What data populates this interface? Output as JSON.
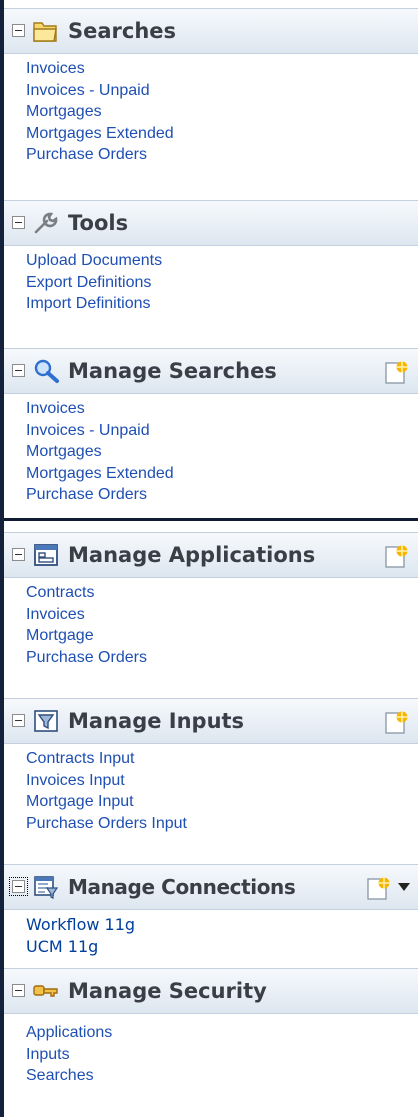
{
  "panels": [
    {
      "id": "searches",
      "title": "Searches",
      "icon": "folder-icon",
      "items": [
        "Invoices",
        "Invoices - Unpaid",
        "Mortgages",
        "Mortgages Extended",
        "Purchase Orders"
      ]
    },
    {
      "id": "tools",
      "title": "Tools",
      "icon": "wrench-icon",
      "items": [
        "Upload Documents",
        "Export Definitions",
        "Import Definitions"
      ]
    },
    {
      "id": "manage-searches",
      "title": "Manage Searches",
      "icon": "magnifier-icon",
      "has_new": true,
      "items": [
        "Invoices",
        "Invoices - Unpaid",
        "Mortgages",
        "Mortgages Extended",
        "Purchase Orders"
      ]
    },
    {
      "id": "manage-applications",
      "title": "Manage Applications",
      "icon": "application-window-icon",
      "has_new": true,
      "items": [
        "Contracts",
        "Invoices",
        "Mortgage",
        "Purchase Orders"
      ]
    },
    {
      "id": "manage-inputs",
      "title": "Manage Inputs",
      "icon": "filter-funnel-icon",
      "has_new": true,
      "items": [
        "Contracts Input",
        "Invoices Input",
        "Mortgage Input",
        "Purchase Orders Input"
      ]
    },
    {
      "id": "manage-connections",
      "title": "Manage Connections",
      "icon": "connection-form-icon",
      "has_new": true,
      "has_menu": true,
      "items": [
        "Workflow 11g",
        "UCM 11g"
      ]
    },
    {
      "id": "manage-security",
      "title": "Manage Security",
      "icon": "key-icon",
      "items": [
        "Applications",
        "Inputs",
        "Searches"
      ]
    }
  ],
  "colors": {
    "link": "#1e4fb3",
    "header_text": "#3a3f47",
    "header_bg": "#dde6f0",
    "rail": "#14213b"
  }
}
